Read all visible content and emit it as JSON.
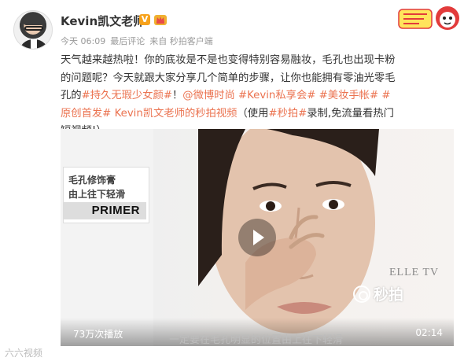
{
  "user": {
    "name": "Kevin凯文老师",
    "verified_badge": "V"
  },
  "meta": {
    "time": "今天 06:09",
    "last_comment": "最后评论",
    "source": "来自 秒拍客户端"
  },
  "post": {
    "segments": [
      {
        "text": "天气越来越热啦！你的底妆是不是也变得特别容易融妆，毛孔也出现卡粉的问题呢？今天就跟大家分享几个简单的步骤，让你也能拥有零油光零毛孔的",
        "tag": false
      },
      {
        "text": "#持久无瑕少女颜#",
        "tag": true
      },
      {
        "text": "！",
        "tag": false
      },
      {
        "text": "@微博时尚",
        "tag": true
      },
      {
        "text": " ",
        "tag": false
      },
      {
        "text": "#Kevin私享会#",
        "tag": true
      },
      {
        "text": " ",
        "tag": false
      },
      {
        "text": "#美妆手帐#",
        "tag": true
      },
      {
        "text": " ",
        "tag": false
      },
      {
        "text": "#原创首发#",
        "tag": true
      },
      {
        "text": " ",
        "tag": false
      },
      {
        "text": "Kevin凯文老师的秒拍视频",
        "tag": true
      },
      {
        "text": "（使用",
        "tag": false
      },
      {
        "text": "#秒拍#",
        "tag": true
      },
      {
        "text": "录制,免流量看热门短视频!）",
        "tag": false
      }
    ]
  },
  "video": {
    "caption_line1": "毛孔修饰膏",
    "caption_line2": "由上往下轻滑",
    "primer_label": "PRIMER",
    "brand_watermark": "ELLE TV",
    "app_watermark": "秒拍",
    "play_count": "73万次播放",
    "duration": "02:14",
    "subtitle": "一定要在毛孔明显的位置由上往下轻滑"
  },
  "footer": {
    "watermark": "六六视频"
  },
  "colors": {
    "tag": "#eb7350",
    "badge": "#f7a21b"
  },
  "icons": {
    "play": "play-icon",
    "crown": "crown-icon",
    "miaopai": "miaopai-logo-icon"
  }
}
